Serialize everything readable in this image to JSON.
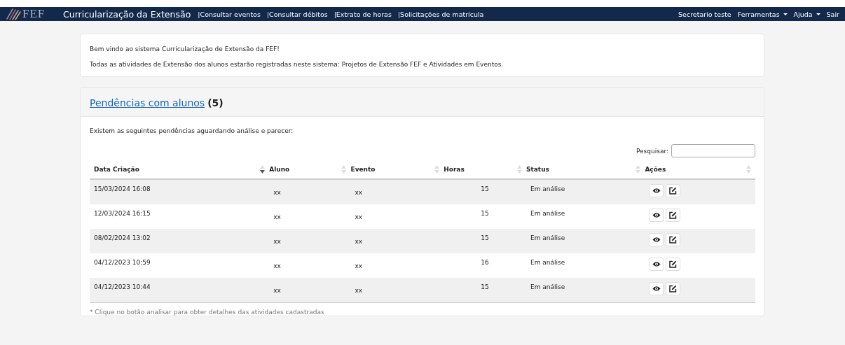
{
  "navbar": {
    "logo": "FEF",
    "brand": "Curricularização da Extensão",
    "links": [
      "|Consultar eventos",
      "|Consultar débitos",
      "|Extrato de horas",
      "|Solicitações de matrícula"
    ],
    "right": [
      {
        "label": "Secretario teste",
        "dropdown": false
      },
      {
        "label": "Ferramentas",
        "dropdown": true
      },
      {
        "label": "Ajuda",
        "dropdown": true
      },
      {
        "label": "Sair",
        "dropdown": false
      }
    ]
  },
  "welcome": [
    "Bem vindo ao sistema Curricularização de Extensão da FEF!",
    "Todas as atividades de Extensão dos alunos estarão registradas neste sistema: Projetos de Extensão FEF e Atividades em Eventos."
  ],
  "pending": {
    "title": "Pendências com alunos",
    "count": "(5)",
    "intro": "Existem as seguintes pendências aguardando análise e parecer:",
    "search_label": "Pesquisar:",
    "columns": [
      {
        "label": "Data Criação",
        "sorted": true
      },
      {
        "label": "Aluno",
        "sorted": false
      },
      {
        "label": "Evento",
        "sorted": false
      },
      {
        "label": "Horas",
        "sorted": false
      },
      {
        "label": "Status",
        "sorted": false
      },
      {
        "label": "Ações",
        "sorted": false
      }
    ],
    "rows": [
      {
        "date": "15/03/2024 16:08",
        "aluno": "xx",
        "evento": "xx",
        "horas": "15",
        "status": "Em análise"
      },
      {
        "date": "12/03/2024 16:15",
        "aluno": "xx",
        "evento": "xx",
        "horas": "15",
        "status": "Em análise"
      },
      {
        "date": "08/02/2024 13:02",
        "aluno": "xx",
        "evento": "xx",
        "horas": "15",
        "status": "Em análise"
      },
      {
        "date": "04/12/2023 10:59",
        "aluno": "xx",
        "evento": "xx",
        "horas": "16",
        "status": "Em análise"
      },
      {
        "date": "04/12/2023 10:44",
        "aluno": "xx",
        "evento": "xx",
        "horas": "15",
        "status": "Em análise"
      }
    ],
    "footnote": "* Clique no botão analisar para obter detalhes das atividades cadastradas"
  }
}
